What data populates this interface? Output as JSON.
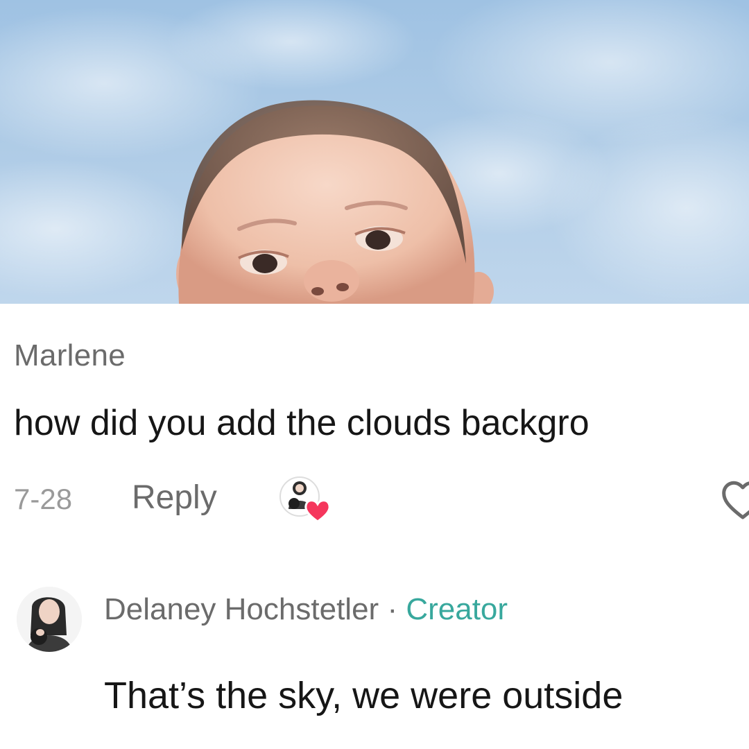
{
  "comment": {
    "username": "Marlene",
    "text": "how did you add the clouds backgro",
    "date": "7-28",
    "reply_label": "Reply",
    "creator_liked": true
  },
  "reply": {
    "author": "Delaney Hochstetler",
    "separator": "·",
    "badge": "Creator",
    "text": "That’s the sky, we were outside"
  },
  "colors": {
    "creator_badge": "#38a89d",
    "like_heart_small": "#f5365c",
    "sky": "#aecbe6"
  },
  "icons": {
    "heart_outline": "heart-outline-icon",
    "creator_liked_badge": "creator-liked-icon"
  }
}
